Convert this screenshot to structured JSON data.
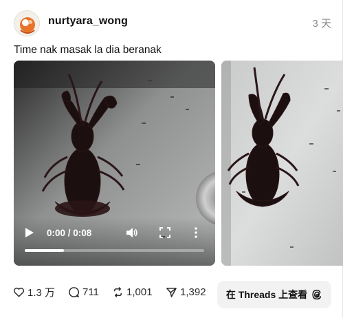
{
  "post": {
    "username": "nurtyara_wong",
    "time": "3 天",
    "caption": "Time nak masak la dia beranak"
  },
  "video": {
    "time_readout": "0:00 / 0:08",
    "progress_fraction": 0.22
  },
  "actions": {
    "likes": "1.3 万",
    "replies": "711",
    "reposts": "1,001",
    "shares": "1,392"
  },
  "open_button": {
    "label": "在 Threads 上查看"
  },
  "icons": [
    "avatar",
    "play-icon",
    "volume-icon",
    "fullscreen-icon",
    "more-icon",
    "heart-icon",
    "comment-icon",
    "repost-icon",
    "share-icon",
    "threads-logo-icon"
  ]
}
